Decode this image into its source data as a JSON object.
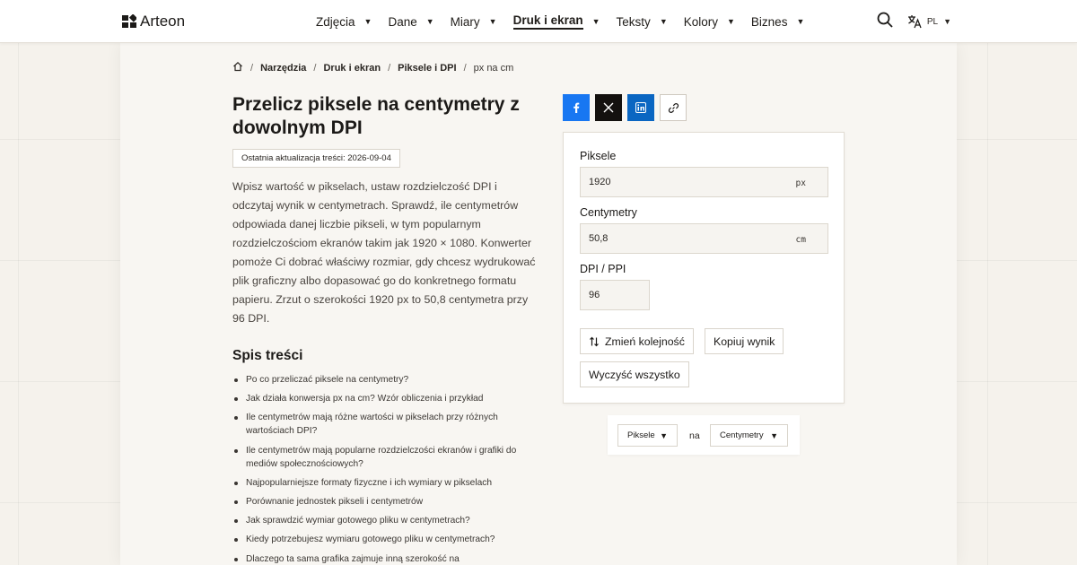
{
  "brand": {
    "name": "Arteon",
    "logo_icon": "arteon-logo-icon"
  },
  "nav": {
    "items": [
      {
        "label": "Zdjęcia",
        "active": false
      },
      {
        "label": "Dane",
        "active": false
      },
      {
        "label": "Miary",
        "active": false
      },
      {
        "label": "Druk i ekran",
        "active": true
      },
      {
        "label": "Teksty",
        "active": false
      },
      {
        "label": "Kolory",
        "active": false
      },
      {
        "label": "Biznes",
        "active": false
      }
    ],
    "caret_icon": "caret-down-icon"
  },
  "header": {
    "search_icon": "search-icon",
    "language_icon": "translate-icon",
    "language_code": "PL"
  },
  "breadcrumb": {
    "home_icon": "home-icon",
    "items": [
      "Narzędzia",
      "Druk i ekran",
      "Piksele i DPI"
    ],
    "current": "px na cm",
    "separator": "/"
  },
  "page": {
    "title": "Przelicz piksele na centymetry z dowolnym DPI",
    "updated": "Ostatnia aktualizacja treści: 2026-09-04",
    "intro": "Wpisz wartość w pikselach, ustaw rozdzielczość DPI i odczytaj wynik w centymetrach. Sprawdź, ile centymetrów odpowiada danej liczbie pikseli, w tym popularnym rozdzielczościom ekranów takim jak 1920 × 1080. Konwerter pomoże Ci dobrać właściwy rozmiar, gdy chcesz wydrukować plik graficzny albo dopasować go do konkretnego formatu papieru. Zrzut o szerokości 1920 px to 50,8 centymetra przy 96 DPI."
  },
  "toc": {
    "title": "Spis treści",
    "items": [
      "Po co przeliczać piksele na centymetry?",
      "Jak działa konwersja px na cm? Wzór obliczenia i przykład",
      "Ile centymetrów mają różne wartości w pikselach przy różnych wartościach DPI?",
      "Ile centymetrów mają popularne rozdzielczości ekranów i grafiki do mediów społecznościowych?",
      "Najpopularniejsze formaty fizyczne i ich wymiary w pikselach",
      "Porównanie jednostek pikseli i centymetrów",
      "Jak sprawdzić wymiar gotowego pliku w centymetrach?",
      "Kiedy potrzebujesz wymiaru gotowego pliku w centymetrach?",
      "Dlaczego ta sama grafika zajmuje inną szerokość na"
    ]
  },
  "share": {
    "items": [
      {
        "icon": "facebook-icon",
        "color": "#1877f2"
      },
      {
        "icon": "x-twitter-icon",
        "color": "#14110f"
      },
      {
        "icon": "linkedin-icon",
        "color": "#0a66c2"
      },
      {
        "icon": "link-icon",
        "color": "#ffffff"
      }
    ]
  },
  "converter": {
    "pixels": {
      "label": "Piksele",
      "value": "1920",
      "unit": "px"
    },
    "centimeters": {
      "label": "Centymetry",
      "value": "50,8",
      "unit": "cm"
    },
    "dpi": {
      "label": "DPI / PPI",
      "value": "96"
    },
    "swap_button": "Zmień kolejność",
    "swap_icon": "swap-vertical-icon",
    "copy_button": "Kopiuj wynik",
    "clear_button": "Wyczyść wszystko"
  },
  "unit_selector": {
    "from": "Piksele",
    "connector": "na",
    "to": "Centymetry"
  }
}
